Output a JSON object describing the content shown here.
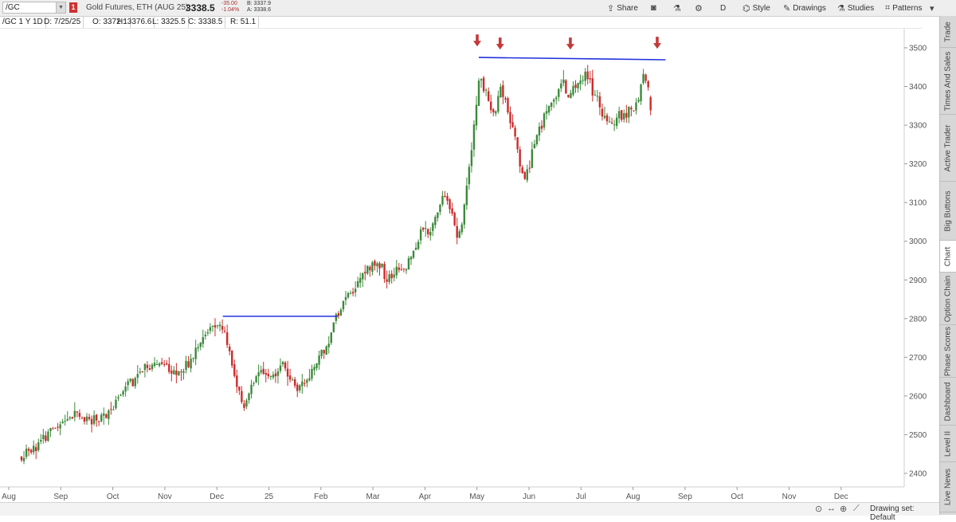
{
  "header": {
    "symbol": "/GC",
    "flag": "1",
    "description": "Gold Futures, ETH (AUG 25)",
    "last": "3338.5",
    "change": "-35.00",
    "change_pct": "-1.04%",
    "bid": "B: 3337.9",
    "ask": "A: 3338.6"
  },
  "toolbar": {
    "share": "Share",
    "timeframe": "D",
    "style": "Style",
    "drawings": "Drawings",
    "studies": "Studies",
    "patterns": "Patterns"
  },
  "info": {
    "symbol_period": "/GC 1 Y 1D",
    "date": "D: 7/25/25",
    "open": "O: 3372.1",
    "high": "H: 3376.6",
    "low": "L: 3325.5",
    "close": "C: 3338.5",
    "range": "R: 51.1"
  },
  "right_tabs": [
    "Trade",
    "Times And Sales",
    "Active Trader",
    "Big Buttons",
    "Chart",
    "Option Chain",
    "Phase Scores",
    "Dashboard",
    "Level II",
    "Live News"
  ],
  "active_tab": "Chart",
  "status": {
    "drawing_set": "Drawing set: Default"
  },
  "colors": {
    "up": "#3b8a3b",
    "down": "#cc2a2a",
    "trendline": "#2233dd",
    "arrow": "#c33a3a"
  },
  "chart_data": {
    "type": "candlestick",
    "symbol": "/GC",
    "period": "1 Y 1D",
    "x_tick_labels": [
      "Aug",
      "Sep",
      "Oct",
      "Nov",
      "Dec",
      "25",
      "Feb",
      "Mar",
      "Apr",
      "May",
      "Jun",
      "Jul",
      "Aug",
      "Sep",
      "Oct",
      "Nov",
      "Dec"
    ],
    "y_ticks": [
      2400,
      2500,
      2600,
      2700,
      2800,
      2900,
      3000,
      3100,
      3200,
      3300,
      3400,
      3500
    ],
    "ylim": [
      2375,
      3575
    ],
    "last_bar": {
      "date": "7/25/25",
      "open": 3372.1,
      "high": 3376.6,
      "low": 3325.5,
      "close": 3338.5
    },
    "price_path": [
      [
        0,
        2440
      ],
      [
        0.3,
        2475
      ],
      [
        0.7,
        2520
      ],
      [
        1.0,
        2550
      ],
      [
        1.3,
        2535
      ],
      [
        1.7,
        2555
      ],
      [
        2.0,
        2630
      ],
      [
        2.3,
        2660
      ],
      [
        2.7,
        2690
      ],
      [
        3.0,
        2660
      ],
      [
        3.3,
        2700
      ],
      [
        3.6,
        2770
      ],
      [
        3.8,
        2790
      ],
      [
        4.0,
        2720
      ],
      [
        4.1,
        2650
      ],
      [
        4.25,
        2570
      ],
      [
        4.5,
        2660
      ],
      [
        4.8,
        2650
      ],
      [
        5.0,
        2690
      ],
      [
        5.15,
        2650
      ],
      [
        5.3,
        2620
      ],
      [
        5.5,
        2640
      ],
      [
        5.7,
        2690
      ],
      [
        5.9,
        2740
      ],
      [
        6.0,
        2790
      ],
      [
        6.15,
        2830
      ],
      [
        6.4,
        2880
      ],
      [
        6.7,
        2940
      ],
      [
        6.9,
        2940
      ],
      [
        7.0,
        2900
      ],
      [
        7.2,
        2920
      ],
      [
        7.4,
        2930
      ],
      [
        7.6,
        2990
      ],
      [
        7.7,
        3040
      ],
      [
        7.85,
        3020
      ],
      [
        8.0,
        3080
      ],
      [
        8.15,
        3120
      ],
      [
        8.3,
        3070
      ],
      [
        8.4,
        3000
      ],
      [
        8.5,
        3080
      ],
      [
        8.6,
        3200
      ],
      [
        8.7,
        3300
      ],
      [
        8.8,
        3420
      ],
      [
        9.0,
        3360
      ],
      [
        9.1,
        3320
      ],
      [
        9.2,
        3400
      ],
      [
        9.3,
        3360
      ],
      [
        9.5,
        3260
      ],
      [
        9.65,
        3150
      ],
      [
        9.8,
        3220
      ],
      [
        10.0,
        3300
      ],
      [
        10.2,
        3370
      ],
      [
        10.4,
        3410
      ],
      [
        10.55,
        3370
      ],
      [
        10.7,
        3410
      ],
      [
        10.85,
        3440
      ],
      [
        11.0,
        3380
      ],
      [
        11.15,
        3340
      ],
      [
        11.3,
        3300
      ],
      [
        11.5,
        3320
      ],
      [
        11.7,
        3340
      ],
      [
        11.85,
        3360
      ],
      [
        11.95,
        3430
      ],
      [
        12.05,
        3400
      ],
      [
        12.12,
        3339
      ]
    ],
    "trendlines": [
      {
        "x1": 3.87,
        "y1": 2806,
        "x2": 6.08,
        "y2": 2806
      },
      {
        "x1": 8.79,
        "y1": 3475,
        "x2": 12.38,
        "y2": 3469
      }
    ],
    "markers": [
      {
        "x": 8.76,
        "y": 3518,
        "shape": "down-arrow"
      },
      {
        "x": 9.2,
        "y": 3510,
        "shape": "down-arrow"
      },
      {
        "x": 10.55,
        "y": 3510,
        "shape": "down-arrow"
      },
      {
        "x": 12.22,
        "y": 3512,
        "shape": "down-arrow"
      }
    ]
  }
}
